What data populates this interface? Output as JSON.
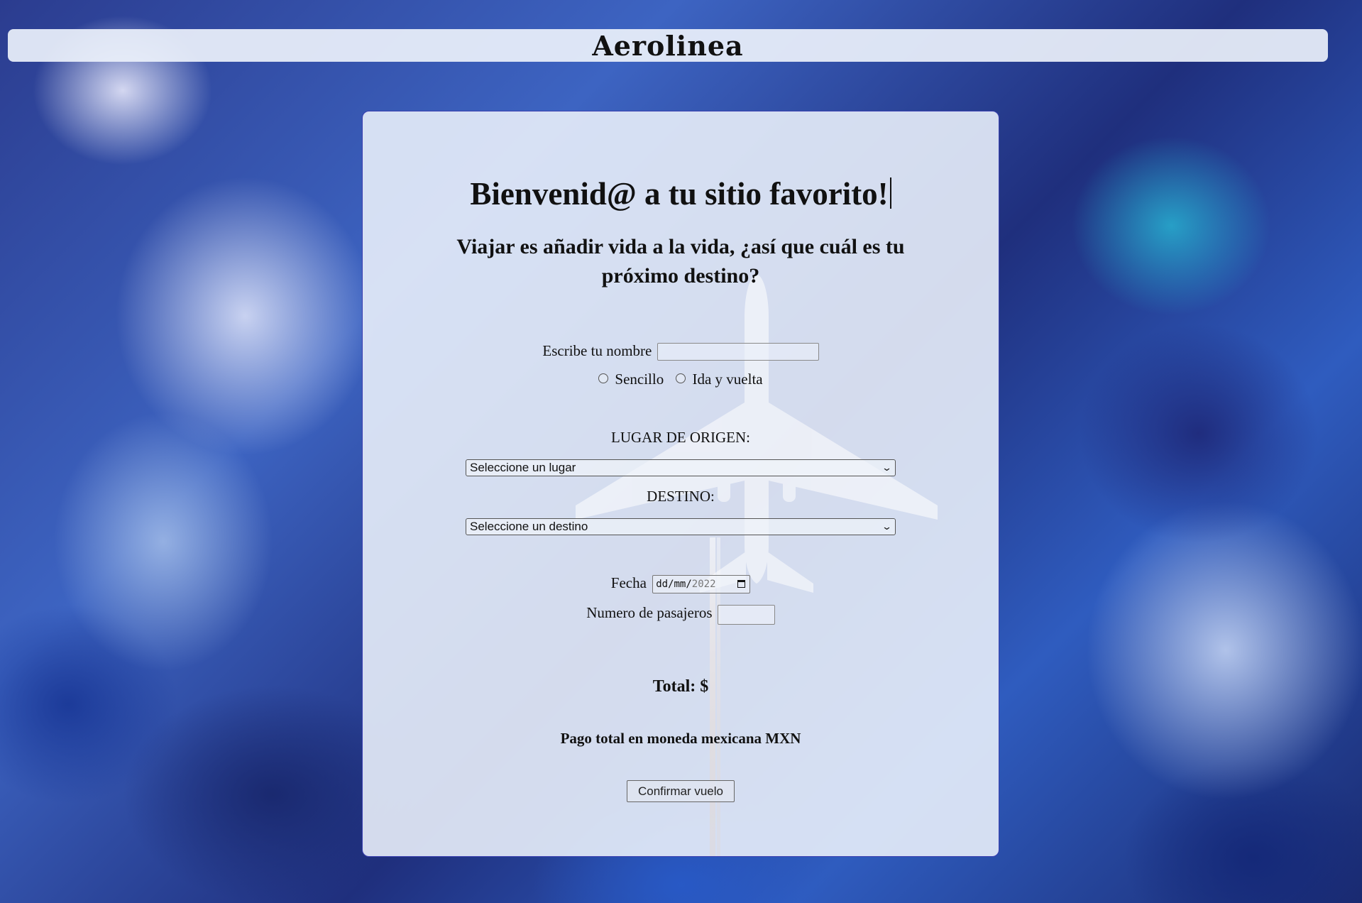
{
  "header": {
    "title": "Aerolinea"
  },
  "card": {
    "welcome": "Bienvenid@ a tu sitio favorito!",
    "subtitle": "Viajar es añadir vida a la vida, ¿así que cuál es tu próximo destino?"
  },
  "form": {
    "name_label": "Escribe tu nombre",
    "name_value": "",
    "trip_type": {
      "options": [
        "Sencillo",
        "Ida y vuelta"
      ],
      "selected": null
    },
    "origin_label": "LUGAR DE ORIGEN:",
    "origin_select": "Seleccione un lugar",
    "destination_label": "DESTINO:",
    "destination_select": "Seleccione un destino",
    "date_label": "Fecha",
    "date_placeholder": {
      "day": "dd",
      "month": "mm",
      "year": "2022",
      "separator": "/"
    },
    "passengers_label": "Numero de pasajeros",
    "passengers_value": "",
    "total_label": "Total: $",
    "currency_note": "Pago total en moneda mexicana MXN",
    "confirm_label": "Confirmar vuelo"
  },
  "icons": {
    "select_chevron": "chevron-down-icon",
    "date_picker": "calendar-icon",
    "radio": "radio-button-icon"
  },
  "colors": {
    "card_border": "#3a3fb0",
    "card_background": "#e8eefa",
    "header_background": "#ebf1fb",
    "text": "#111111"
  }
}
